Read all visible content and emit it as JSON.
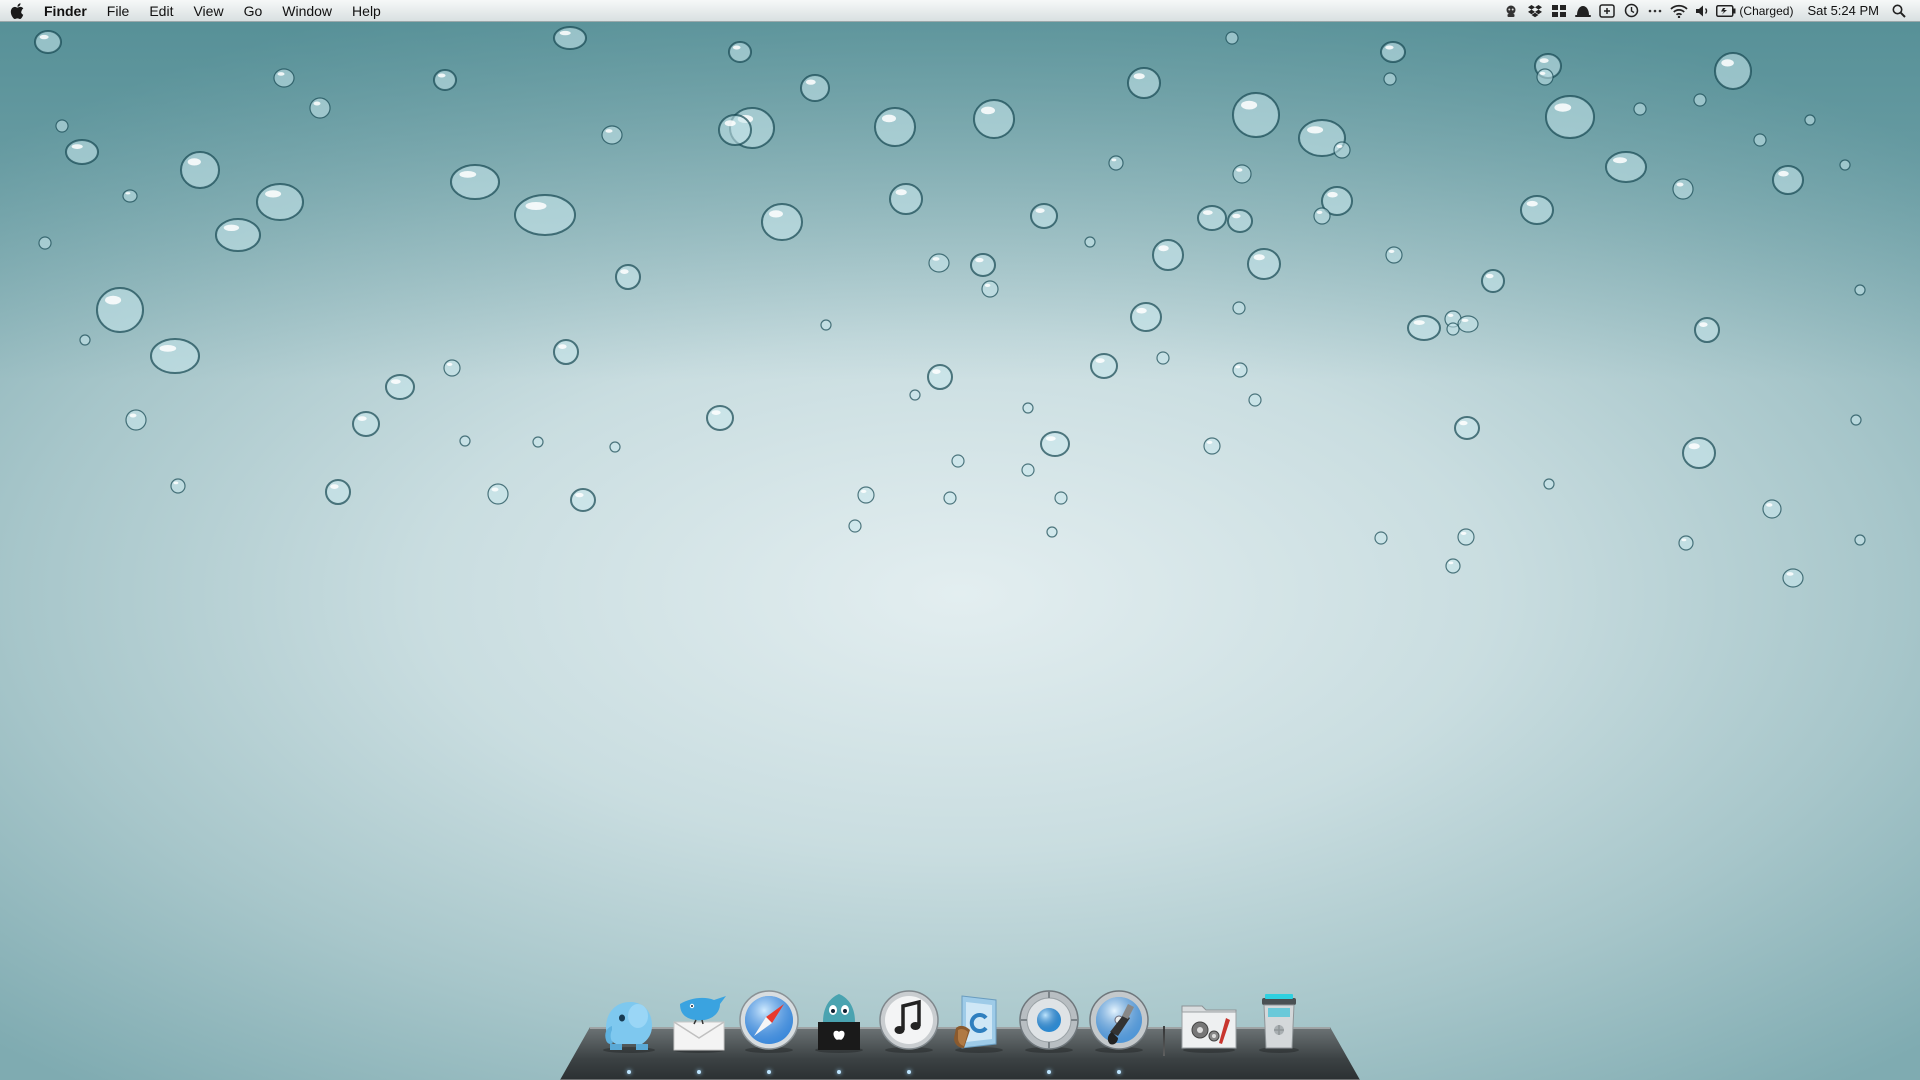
{
  "menubar": {
    "apple_icon": "apple-logo-icon",
    "app_name": "Finder",
    "menus": [
      "File",
      "Edit",
      "View",
      "Go",
      "Window",
      "Help"
    ],
    "status_icons": [
      "growl-icon",
      "dropbox-icon",
      "grid-icon",
      "notification-bell-icon",
      "add-box-icon",
      "time-machine-icon",
      "more-dots-icon",
      "wifi-icon",
      "volume-icon",
      "battery-icon"
    ],
    "battery_label": "(Charged)",
    "clock": "Sat 5:24 PM",
    "spotlight_icon": "spotlight-search-icon"
  },
  "dock": {
    "apps": [
      {
        "icon": "evernote-elephant-icon",
        "running": true
      },
      {
        "icon": "mail-bird-icon",
        "running": true
      },
      {
        "icon": "safari-compass-icon",
        "running": true
      },
      {
        "icon": "app-store-icon",
        "running": true
      },
      {
        "icon": "itunes-music-icon",
        "running": true
      },
      {
        "icon": "contacts-book-icon",
        "running": false
      },
      {
        "icon": "lens-app-icon",
        "running": true
      },
      {
        "icon": "disk-utility-icon",
        "running": true
      }
    ],
    "right": [
      {
        "icon": "system-preferences-folder-icon",
        "running": false
      },
      {
        "icon": "trash-icon",
        "running": false
      }
    ]
  },
  "colors": {
    "wallpaper_center": "#e3eef0",
    "wallpaper_edge": "#7fabb1",
    "dock_shelf": "#3c4244",
    "dock_indicator": "#bfe6ff"
  }
}
